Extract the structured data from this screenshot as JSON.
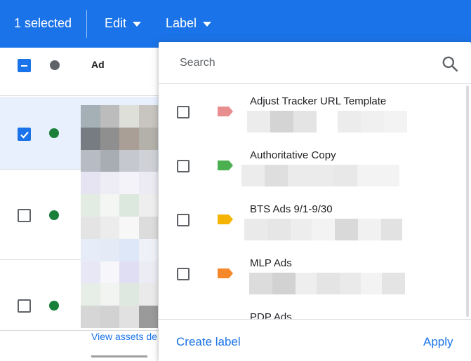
{
  "toolbar": {
    "selected_text": "1 selected",
    "edit_label": "Edit",
    "label_label": "Label"
  },
  "table": {
    "ad_column_header": "Ad",
    "view_assets_text": "View assets de"
  },
  "label_menu": {
    "search_placeholder": "Search",
    "labels": [
      {
        "name": "Adjust Tracker URL Template",
        "color": "#e88e8e",
        "checked": false
      },
      {
        "name": "Authoritative Copy",
        "color": "#4caf50",
        "checked": false
      },
      {
        "name": "BTS Ads 9/1-9/30",
        "color": "#f4b400",
        "checked": false
      },
      {
        "name": "MLP Ads",
        "color": "#f6882a",
        "checked": false
      },
      {
        "name": "PDP Ads",
        "color": "#2bc4b4",
        "checked": false
      }
    ],
    "create_label": "Create label",
    "apply_label": "Apply"
  },
  "colors": {
    "brand_blue": "#1a73e8",
    "status_green": "#188038",
    "selected_row": "#e8f0fe"
  }
}
